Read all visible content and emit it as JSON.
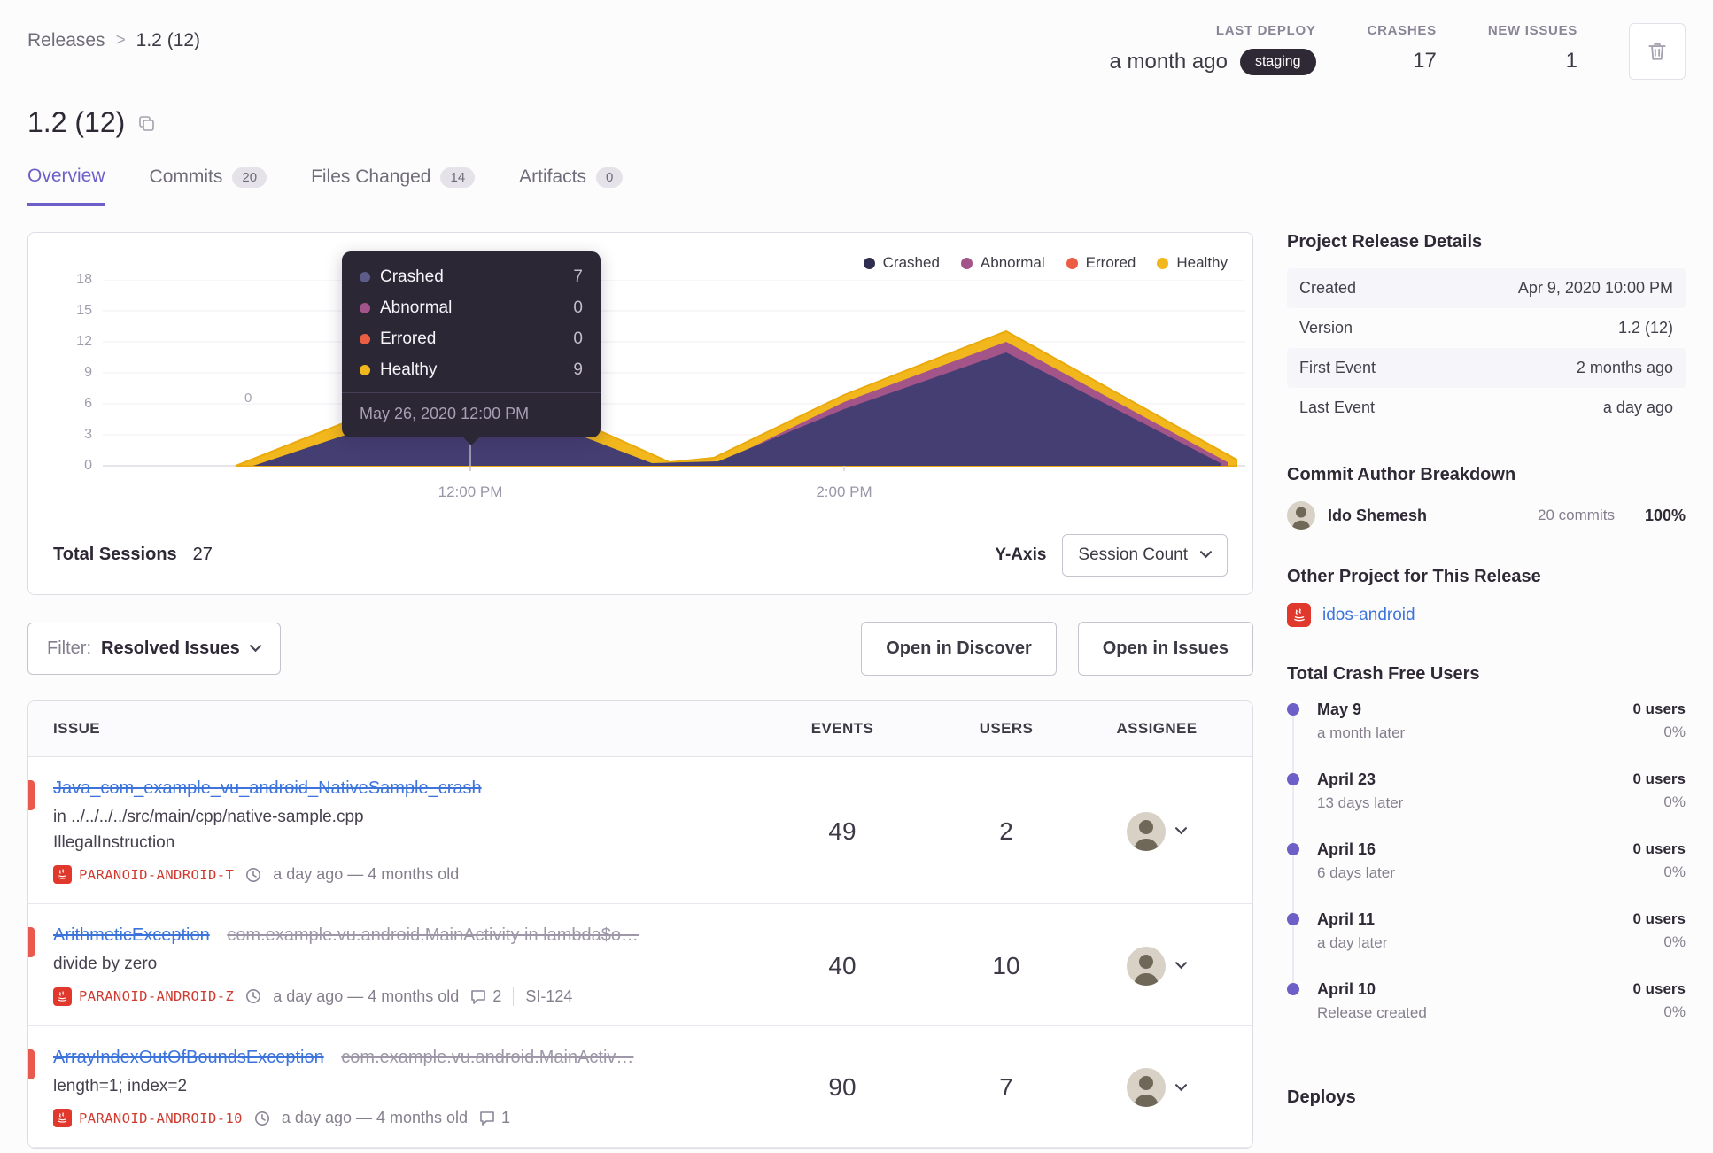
{
  "breadcrumb": {
    "parent": "Releases",
    "separator": ">",
    "current": "1.2 (12)"
  },
  "header": {
    "last_deploy_label": "LAST DEPLOY",
    "last_deploy_value": "a month ago",
    "last_deploy_badge": "staging",
    "crashes_label": "CRASHES",
    "crashes_value": "17",
    "new_issues_label": "NEW ISSUES",
    "new_issues_value": "1"
  },
  "title": "1.2 (12)",
  "tabs": {
    "overview": "Overview",
    "commits": "Commits",
    "commits_count": "20",
    "files": "Files Changed",
    "files_count": "14",
    "artifacts": "Artifacts",
    "artifacts_count": "0"
  },
  "chart": {
    "legend": [
      {
        "label": "Crashed",
        "color": "#2f2d50"
      },
      {
        "label": "Abnormal",
        "color": "#a35488"
      },
      {
        "label": "Errored",
        "color": "#ec5e44"
      },
      {
        "label": "Healthy",
        "color": "#f1b71c"
      }
    ],
    "y_ticks": [
      "18",
      "15",
      "12",
      "9",
      "6",
      "3",
      "0"
    ],
    "x_ticks": [
      "12:00 PM",
      "2:00 PM"
    ],
    "stray_label": "0",
    "tooltip": {
      "rows": [
        {
          "label": "Crashed",
          "value": "7"
        },
        {
          "label": "Abnormal",
          "value": "0"
        },
        {
          "label": "Errored",
          "value": "0"
        },
        {
          "label": "Healthy",
          "value": "9"
        }
      ],
      "date": "May 26, 2020 12:00 PM"
    },
    "footer": {
      "total_sessions_label": "Total Sessions",
      "total_sessions_value": "27",
      "y_axis_label": "Y-Axis",
      "y_axis_value": "Session Count"
    }
  },
  "filter_bar": {
    "filter_label": "Filter:",
    "filter_value": "Resolved Issues",
    "open_discover": "Open in Discover",
    "open_issues": "Open in Issues"
  },
  "issues": {
    "columns": {
      "issue": "ISSUE",
      "events": "EVENTS",
      "users": "USERS",
      "assignee": "ASSIGNEE"
    },
    "rows": [
      {
        "title": "Java_com_example_vu_android_NativeSample_crash",
        "location": "in ../../../../src/main/cpp/native-sample.cpp",
        "extra": "IllegalInstruction",
        "project": "PARANOID-ANDROID-T",
        "age": "a day ago — 4 months old",
        "events": "49",
        "users": "2"
      },
      {
        "title": "ArithmeticException",
        "subtitle": "com.example.vu.android.MainActivity in lambda$o…",
        "extra": "divide by zero",
        "project": "PARANOID-ANDROID-Z",
        "age": "a day ago — 4 months old",
        "comments": "2",
        "short_id": "SI-124",
        "events": "40",
        "users": "10"
      },
      {
        "title": "ArrayIndexOutOfBoundsException",
        "subtitle": "com.example.vu.android.MainActiv…",
        "extra": "length=1; index=2",
        "project": "PARANOID-ANDROID-10",
        "age": "a day ago — 4 months old",
        "comments": "1",
        "events": "90",
        "users": "7"
      }
    ]
  },
  "sidebar": {
    "details": {
      "heading": "Project Release Details",
      "rows": [
        {
          "label": "Created",
          "value": "Apr 9, 2020 10:00 PM"
        },
        {
          "label": "Version",
          "value": "1.2 (12)"
        },
        {
          "label": "First Event",
          "value": "2 months ago"
        },
        {
          "label": "Last Event",
          "value": "a day ago"
        }
      ]
    },
    "authors": {
      "heading": "Commit Author Breakdown",
      "name": "Ido Shemesh",
      "commits": "20 commits",
      "percent": "100%"
    },
    "other": {
      "heading": "Other Project for This Release",
      "link": "idos-android"
    },
    "crash_free": {
      "heading": "Total Crash Free Users",
      "entries": [
        {
          "date": "May 9",
          "sub": "a month later",
          "users": "0 users",
          "percent": "0%"
        },
        {
          "date": "April 23",
          "sub": "13 days later",
          "users": "0 users",
          "percent": "0%"
        },
        {
          "date": "April 16",
          "sub": "6 days later",
          "users": "0 users",
          "percent": "0%"
        },
        {
          "date": "April 11",
          "sub": "a day later",
          "users": "0 users",
          "percent": "0%"
        },
        {
          "date": "April 10",
          "sub": "Release created",
          "users": "0 users",
          "percent": "0%"
        }
      ]
    },
    "deploys_heading": "Deploys"
  }
}
